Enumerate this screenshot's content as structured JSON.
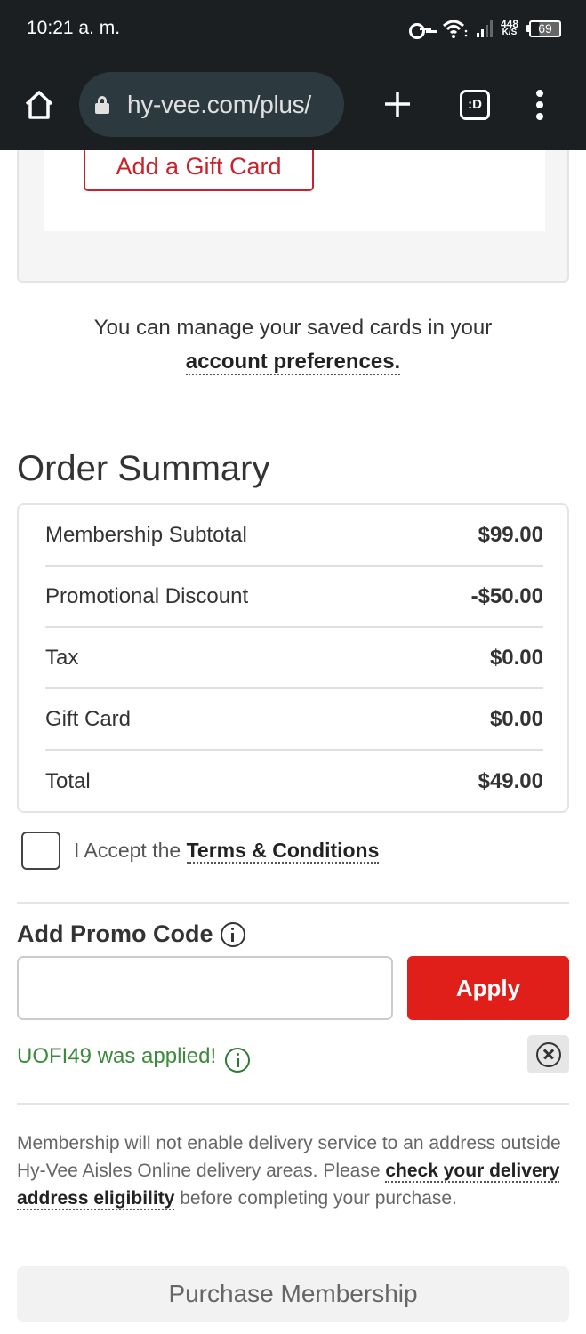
{
  "status_bar": {
    "time": "10:21 a. m.",
    "network_speed_value": "448",
    "network_speed_unit": "K/S",
    "battery_level": "69"
  },
  "browser": {
    "url": "hy-vee.com/plus/",
    "tabs_label": ":D"
  },
  "payment": {
    "add_gift_card_label": "Add a Gift Card",
    "manage_text": "You can manage your saved cards in your",
    "account_preferences_link": "account preferences."
  },
  "order_summary": {
    "title": "Order Summary",
    "rows": [
      {
        "label": "Membership Subtotal",
        "value": "$99.00"
      },
      {
        "label": "Promotional Discount",
        "value": "-$50.00"
      },
      {
        "label": "Tax",
        "value": "$0.00"
      },
      {
        "label": "Gift Card",
        "value": "$0.00"
      },
      {
        "label": "Total",
        "value": "$49.00"
      }
    ]
  },
  "terms": {
    "accept_prefix": "I Accept the ",
    "link_label": "Terms & Conditions",
    "checked": false
  },
  "promo": {
    "title": "Add Promo Code",
    "input_value": "",
    "input_placeholder": "",
    "apply_label": "Apply",
    "applied_message": "UOFI49 was applied!"
  },
  "notice": {
    "text_before": "Membership will not enable delivery service to an address outside Hy-Vee Aisles Online delivery areas. Please ",
    "link_label": "check your delivery address eligibility",
    "text_after": " before completing your purchase."
  },
  "purchase_button_label": "Purchase Membership",
  "colors": {
    "brand_red": "#e01f1a",
    "gift_card_red": "#c8232c",
    "success_green": "#3c8a3c",
    "chrome_bg": "#1c1f22"
  }
}
